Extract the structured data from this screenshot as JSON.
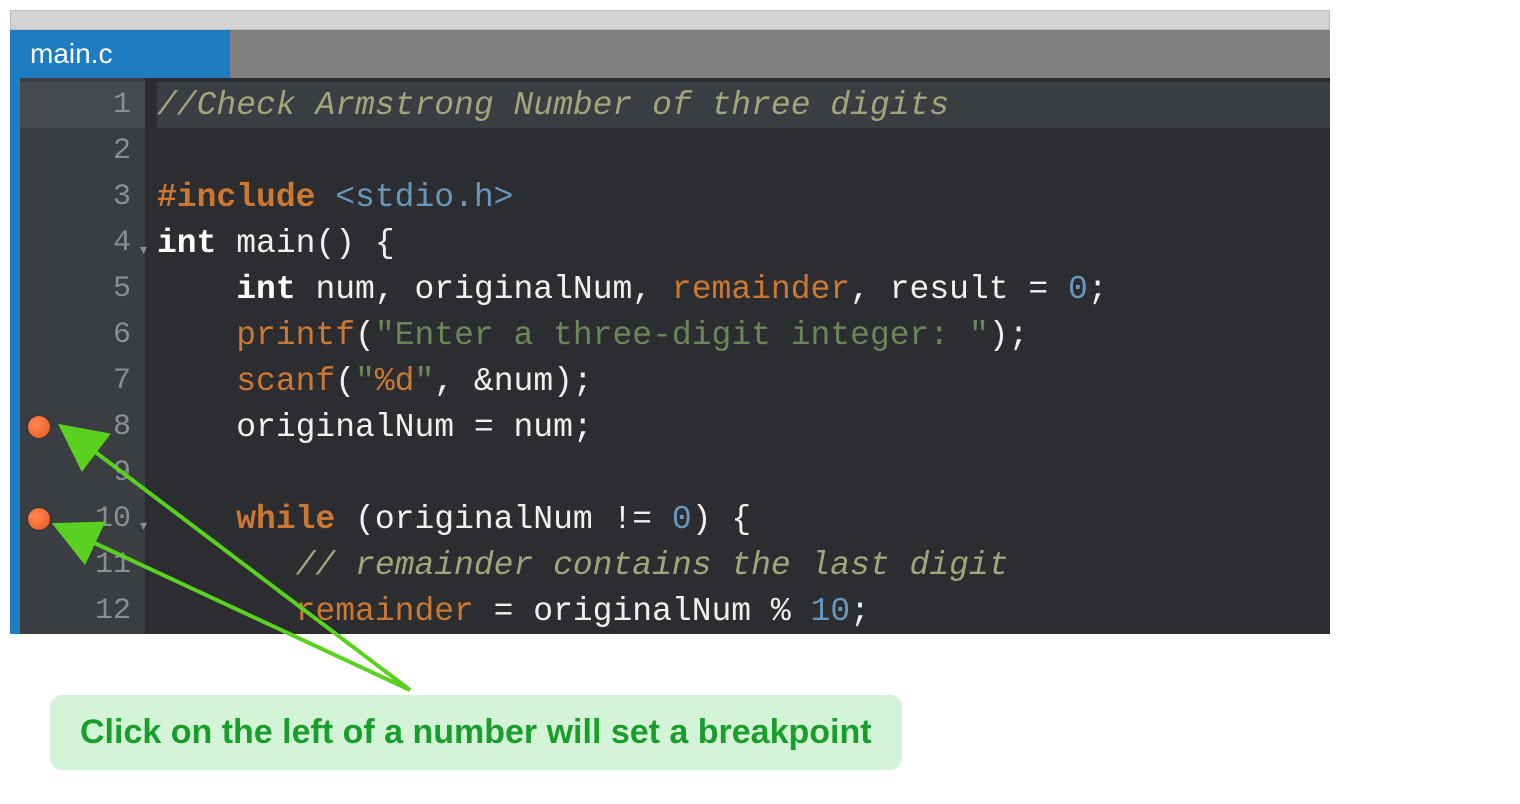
{
  "tab": {
    "filename": "main.c"
  },
  "callout": {
    "text": "Click on the left of a number will set a breakpoint"
  },
  "breakpoints": [
    8,
    10
  ],
  "code": {
    "lines": [
      {
        "n": 1,
        "tokens": [
          {
            "t": "//Check Armstrong Number of three digits",
            "c": "c-comment"
          }
        ],
        "active": true
      },
      {
        "n": 2,
        "tokens": []
      },
      {
        "n": 3,
        "tokens": [
          {
            "t": "#include ",
            "c": "c-preproc"
          },
          {
            "t": "<stdio.h>",
            "c": "c-header"
          }
        ]
      },
      {
        "n": 4,
        "tokens": [
          {
            "t": "int",
            "c": "c-type"
          },
          {
            "t": " ",
            "c": "c-plain"
          },
          {
            "t": "main",
            "c": "c-plain"
          },
          {
            "t": "() {",
            "c": "c-plain"
          }
        ],
        "fold": true
      },
      {
        "n": 5,
        "tokens": [
          {
            "t": "    ",
            "c": "c-plain"
          },
          {
            "t": "int",
            "c": "c-type"
          },
          {
            "t": " num, originalNum, ",
            "c": "c-plain"
          },
          {
            "t": "remainder",
            "c": "c-var-remainder"
          },
          {
            "t": ", result = ",
            "c": "c-plain"
          },
          {
            "t": "0",
            "c": "c-number"
          },
          {
            "t": ";",
            "c": "c-plain"
          }
        ]
      },
      {
        "n": 6,
        "tokens": [
          {
            "t": "    ",
            "c": "c-plain"
          },
          {
            "t": "printf",
            "c": "c-func"
          },
          {
            "t": "(",
            "c": "c-plain"
          },
          {
            "t": "\"Enter a three-digit integer: \"",
            "c": "c-string"
          },
          {
            "t": ");",
            "c": "c-plain"
          }
        ]
      },
      {
        "n": 7,
        "tokens": [
          {
            "t": "    ",
            "c": "c-plain"
          },
          {
            "t": "scanf",
            "c": "c-func"
          },
          {
            "t": "(",
            "c": "c-plain"
          },
          {
            "t": "\"",
            "c": "c-string"
          },
          {
            "t": "%d",
            "c": "c-fmt"
          },
          {
            "t": "\"",
            "c": "c-string"
          },
          {
            "t": ", &num);",
            "c": "c-plain"
          }
        ]
      },
      {
        "n": 8,
        "tokens": [
          {
            "t": "    originalNum = num;",
            "c": "c-plain"
          }
        ]
      },
      {
        "n": 9,
        "tokens": []
      },
      {
        "n": 10,
        "tokens": [
          {
            "t": "    ",
            "c": "c-plain"
          },
          {
            "t": "while",
            "c": "c-while"
          },
          {
            "t": " (originalNum != ",
            "c": "c-plain"
          },
          {
            "t": "0",
            "c": "c-number"
          },
          {
            "t": ") {",
            "c": "c-plain"
          }
        ],
        "fold": true
      },
      {
        "n": 11,
        "tokens": [
          {
            "t": "       ",
            "c": "c-plain"
          },
          {
            "t": "// remainder contains the last digit",
            "c": "c-comment"
          }
        ]
      },
      {
        "n": 12,
        "tokens": [
          {
            "t": "       ",
            "c": "c-plain"
          },
          {
            "t": "remainder",
            "c": "c-var-remainder"
          },
          {
            "t": " = originalNum % ",
            "c": "c-plain"
          },
          {
            "t": "10",
            "c": "c-number"
          },
          {
            "t": ";",
            "c": "c-plain"
          }
        ]
      }
    ]
  }
}
